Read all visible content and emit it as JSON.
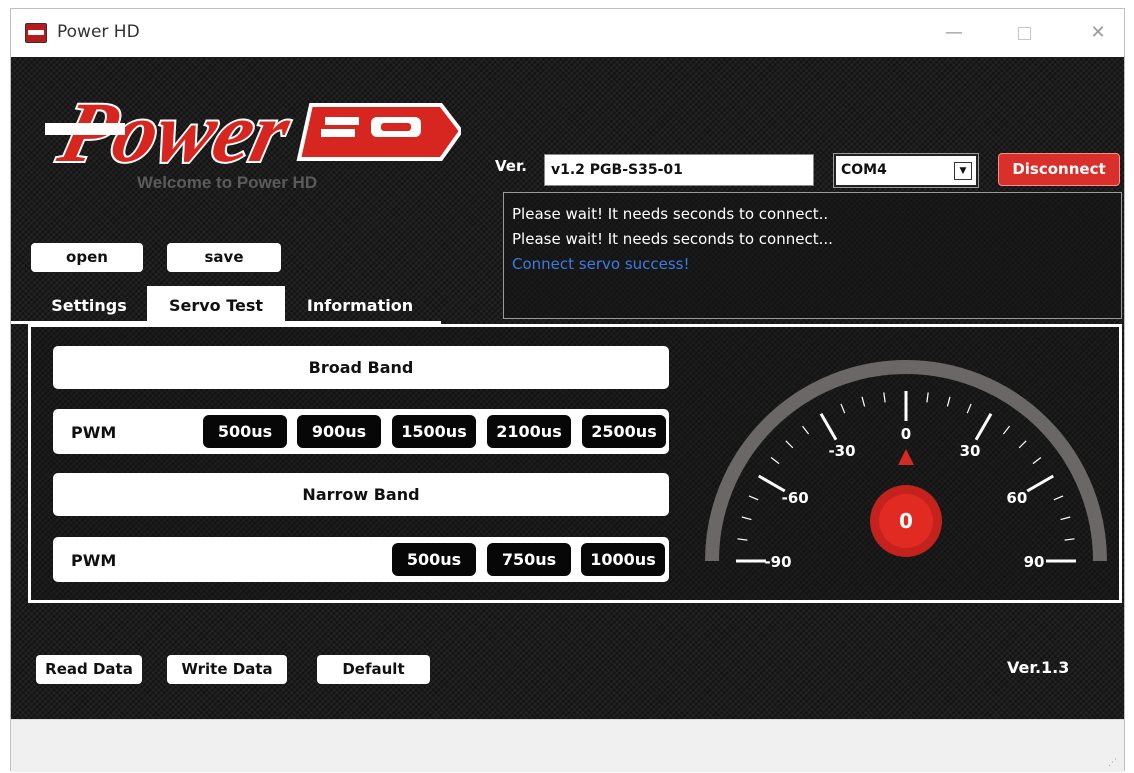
{
  "window": {
    "title": "Power HD",
    "minimize": "—",
    "close": "✕"
  },
  "logo": {
    "wordmark": "Power HD",
    "welcome": "Welcome to Power HD"
  },
  "file_buttons": {
    "open": "open",
    "save": "save"
  },
  "connection": {
    "ver_label": "Ver.",
    "version_value": "v1.2 PGB-S35-01",
    "port_value": "COM4",
    "dropdown_arrow": "▼",
    "disconnect_label": "Disconnect",
    "disconnect_color": "#d9302c"
  },
  "log": {
    "lines": [
      "Please wait! It needs seconds to connect..",
      "Please wait! It needs seconds to connect...",
      "Connect servo success!"
    ],
    "success_color": "#3d7be0"
  },
  "tabs": [
    {
      "label": "Settings",
      "active": false
    },
    {
      "label": "Servo Test",
      "active": true
    },
    {
      "label": "Information",
      "active": false
    }
  ],
  "servo_test": {
    "broad_band": {
      "title": "Broad Band",
      "pwm_label": "PWM",
      "buttons": [
        "500us",
        "900us",
        "1500us",
        "2100us",
        "2500us"
      ]
    },
    "narrow_band": {
      "title": "Narrow Band",
      "pwm_label": "PWM",
      "buttons": [
        "500us",
        "750us",
        "1000us"
      ]
    },
    "gauge": {
      "tick_labels": [
        "-90",
        "-60",
        "-30",
        "0",
        "30",
        "60",
        "90"
      ],
      "current_value": "0",
      "pointer_color": "#d42a22"
    }
  },
  "bottom_buttons": {
    "read": "Read Data",
    "write": "Write Data",
    "default": "Default"
  },
  "footer": {
    "version": "Ver.1.3"
  },
  "statusbar": {
    "grip": "⋰"
  }
}
